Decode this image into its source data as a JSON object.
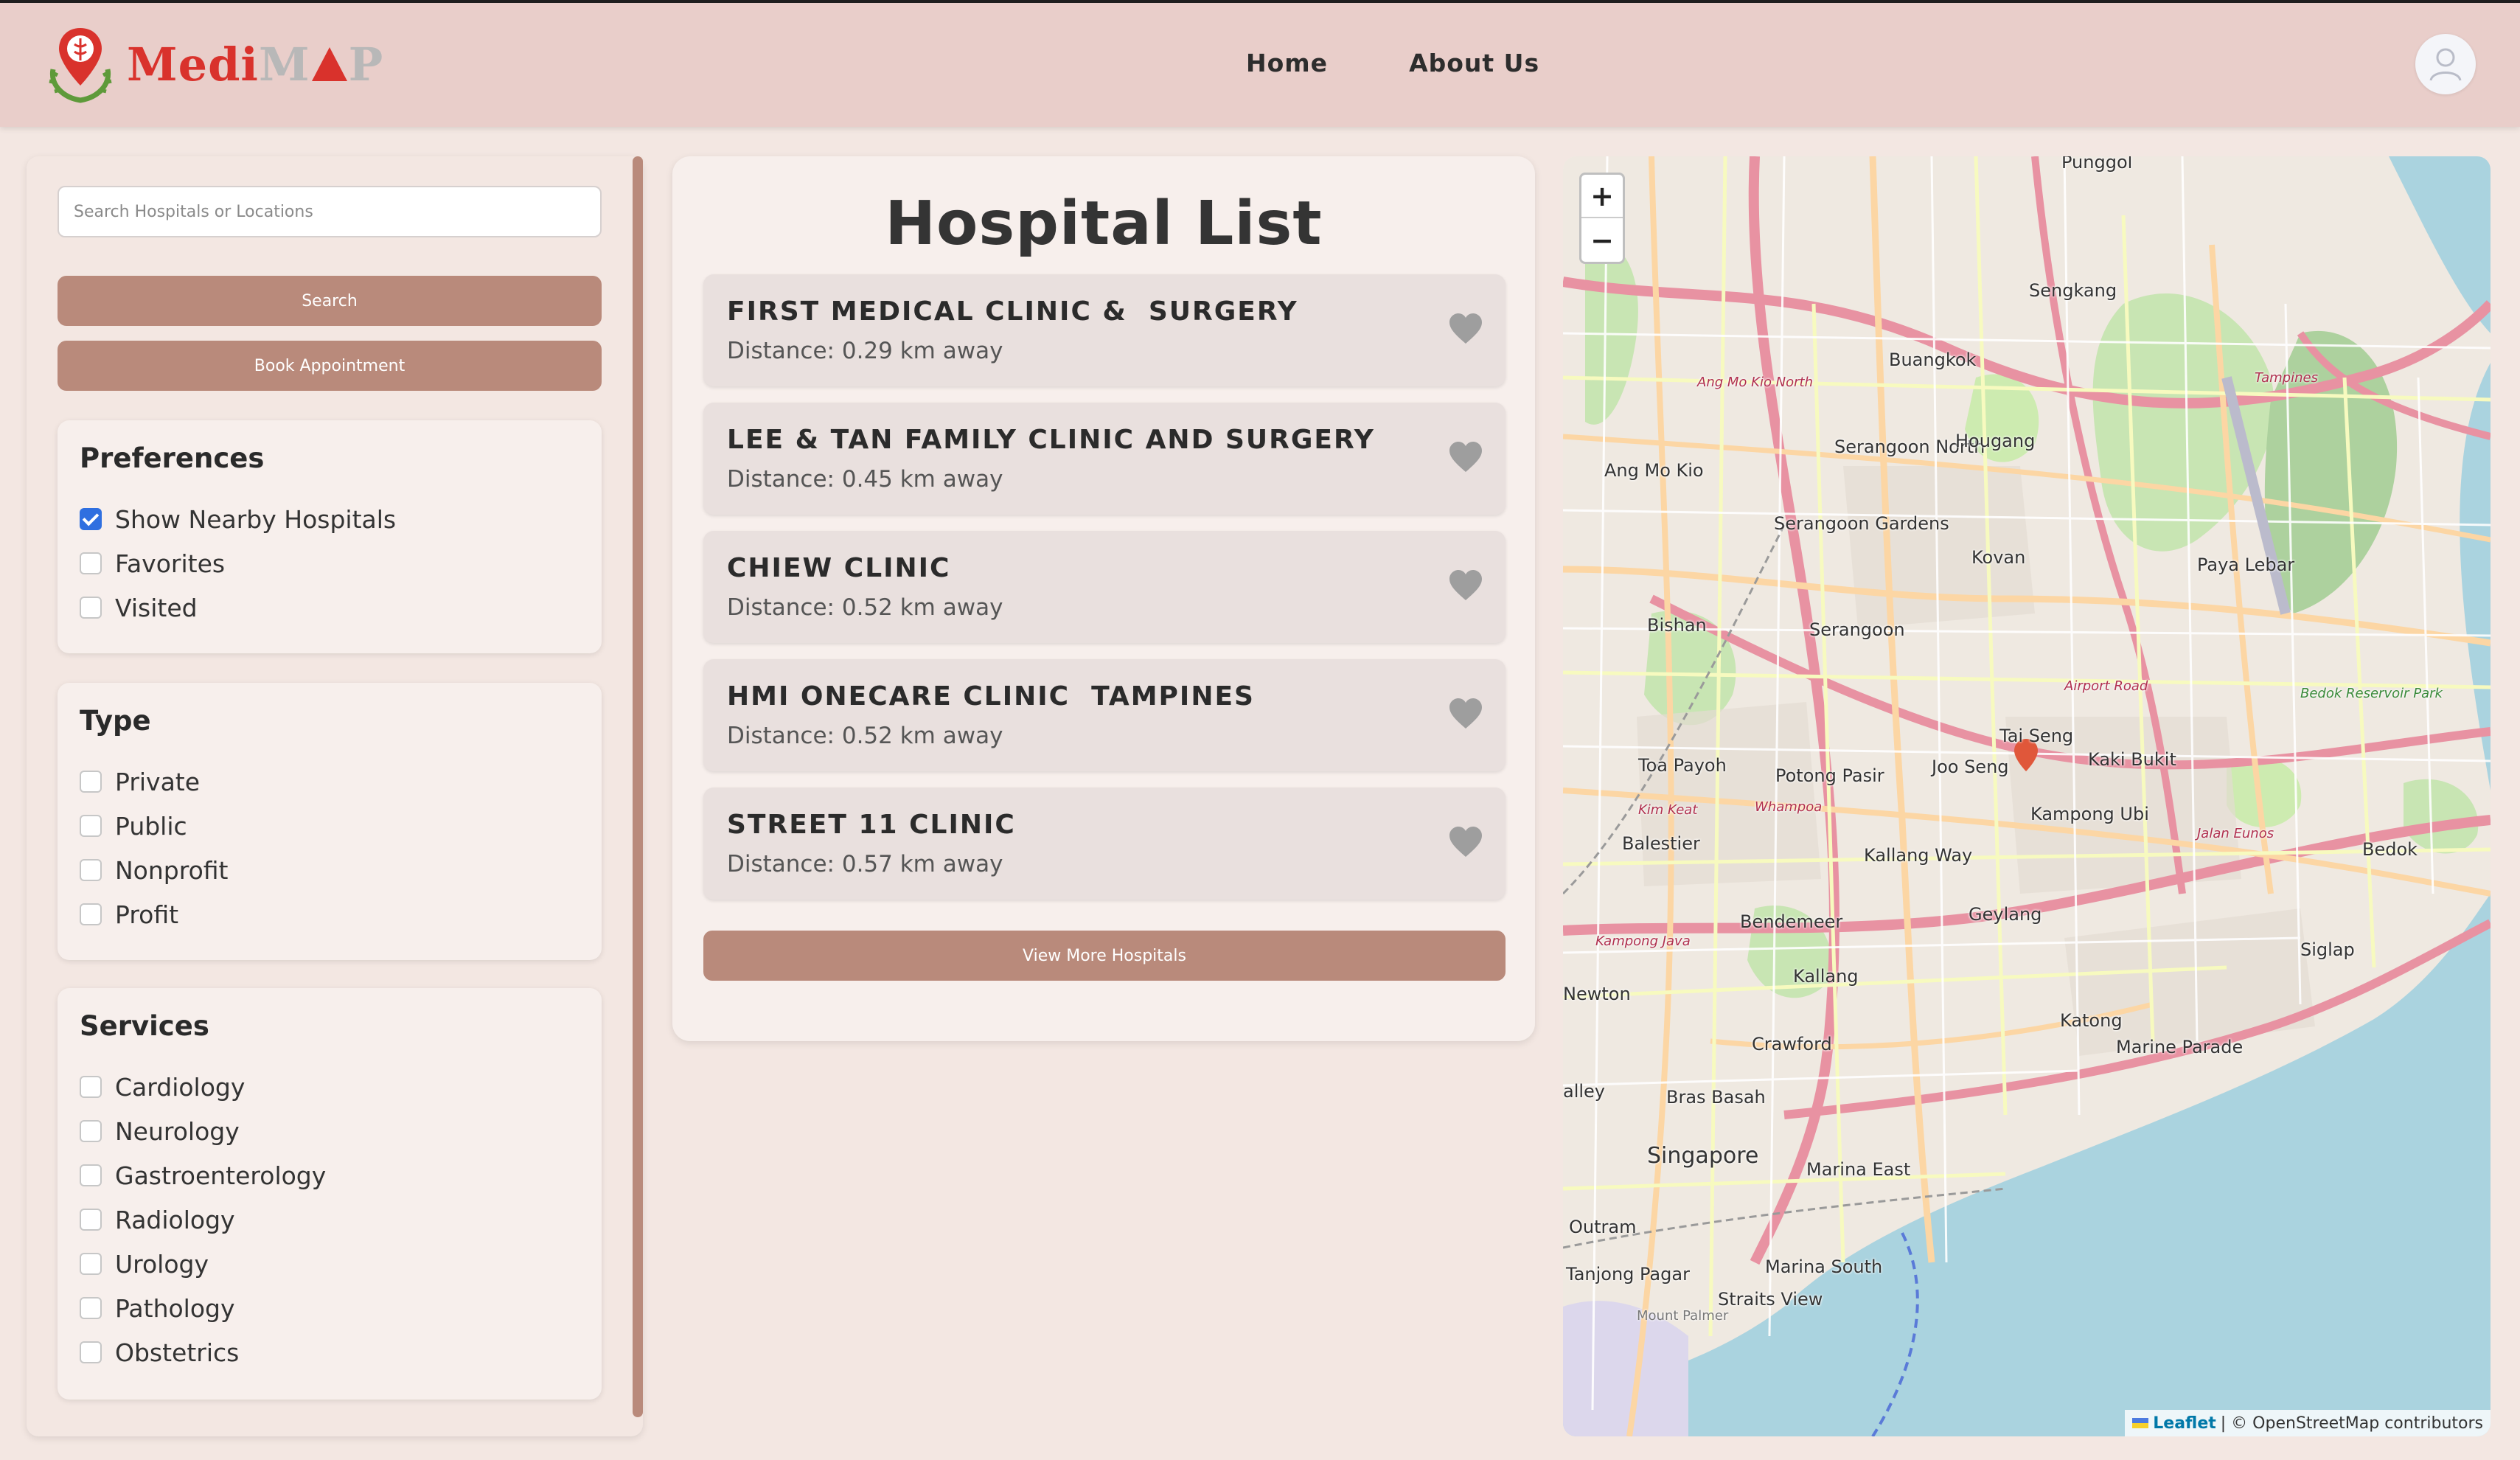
{
  "brand": {
    "part1": "Medi",
    "part2": "M",
    "part3": "P"
  },
  "nav": {
    "home": "Home",
    "about": "About Us"
  },
  "sidebar": {
    "search_placeholder": "Search Hospitals or Locations",
    "search_button": "Search",
    "book_button": "Book Appointment",
    "preferences": {
      "title": "Preferences",
      "options": [
        {
          "label": "Show Nearby Hospitals",
          "checked": true
        },
        {
          "label": "Favorites",
          "checked": false
        },
        {
          "label": "Visited",
          "checked": false
        }
      ]
    },
    "type": {
      "title": "Type",
      "options": [
        {
          "label": "Private",
          "checked": false
        },
        {
          "label": "Public",
          "checked": false
        },
        {
          "label": "Nonprofit",
          "checked": false
        },
        {
          "label": "Profit",
          "checked": false
        }
      ]
    },
    "services": {
      "title": "Services",
      "options": [
        {
          "label": "Cardiology",
          "checked": false
        },
        {
          "label": "Neurology",
          "checked": false
        },
        {
          "label": "Gastroenterology",
          "checked": false
        },
        {
          "label": "Radiology",
          "checked": false
        },
        {
          "label": "Urology",
          "checked": false
        },
        {
          "label": "Pathology",
          "checked": false
        },
        {
          "label": "Obstetrics",
          "checked": false
        }
      ]
    }
  },
  "hospital_list": {
    "title": "Hospital List",
    "items": [
      {
        "name": "FIRST MEDICAL CLINIC &  SURGERY",
        "distance": "Distance: 0.29 km away"
      },
      {
        "name": "LEE & TAN FAMILY CLINIC AND SURGERY",
        "distance": "Distance: 0.45 km away"
      },
      {
        "name": "CHIEW CLINIC",
        "distance": "Distance: 0.52 km away"
      },
      {
        "name": "HMI ONECARE CLINIC  TAMPINES",
        "distance": "Distance: 0.52 km away"
      },
      {
        "name": "STREET 11 CLINIC",
        "distance": "Distance: 0.57 km away"
      }
    ],
    "more_button": "View More Hospitals"
  },
  "map": {
    "zoom_in": "+",
    "zoom_out": "−",
    "attribution_link": "Leaflet",
    "attribution_text": "| © OpenStreetMap contributors",
    "labels": {
      "punggol": "Punggol",
      "sengkang": "Sengkang",
      "buangkok": "Buangkok",
      "serangoon_north": "Serangoon North",
      "hougang": "Hougang",
      "ang_mo_kio": "Ang Mo Kio",
      "serangoon_gardens": "Serangoon Gardens",
      "kovan": "Kovan",
      "paya_lebar": "Paya Lebar",
      "bishan": "Bishan",
      "serangoon": "Serangoon",
      "tai_seng": "Tai Seng",
      "toa_payoh": "Toa Payoh",
      "potong_pasir": "Potong Pasir",
      "joo_seng": "Joo Seng",
      "kaki_bukit": "Kaki Bukit",
      "balestier": "Balestier",
      "kampong_ubi": "Kampong Ubi",
      "bedok": "Bedok",
      "kallang_way": "Kallang Way",
      "geylang": "Geylang",
      "bendemeer": "Bendemeer",
      "siglap": "Siglap",
      "kallang": "Kallang",
      "katong": "Katong",
      "marine_parade": "Marine Parade",
      "crawford": "Crawford",
      "bras_basah": "Bras Basah",
      "singapore": "Singapore",
      "marina_east": "Marina East",
      "outram": "Outram",
      "marina_south": "Marina South",
      "tanjong_pagar": "Tanjong Pagar",
      "straits_view": "Straits View",
      "mount_palmer": "Mount Palmer",
      "ang_mo_kio_north": "Ang Mo Kio North",
      "tampines": "Tampines",
      "airport_road": "Airport Road",
      "bedok_reservoir_park": "Bedok Reservoir Park",
      "jalan_eunos": "Jalan Eunos",
      "kim_keat": "Kim Keat",
      "whampoa": "Whampoa",
      "kampong_java": "Kampong Java",
      "newton": "Newton",
      "alley": "alley"
    }
  },
  "colors": {
    "navbar": "#e9ceca",
    "accent": "#b98a7b",
    "page": "#f3e7e2",
    "checkbox_checked": "#2f6fe0",
    "logo_red": "#d9322c"
  },
  "icons": {
    "avatar": "user-avatar-icon",
    "heart": "heart-icon",
    "logo": "map-pin-caduceus-icon"
  }
}
